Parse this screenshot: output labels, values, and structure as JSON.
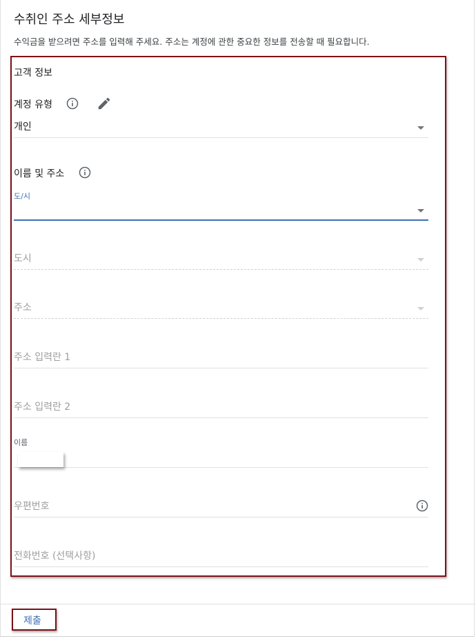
{
  "header": {
    "title": "수취인 주소 세부정보",
    "subtitle": "수익금을 받으려면 주소를 입력해 주세요. 주소는 계정에 관한 중요한 정보를 전송할 때 필요합니다."
  },
  "form": {
    "section_title": "고객 정보",
    "account_type": {
      "label": "계정 유형",
      "value": "개인",
      "info_icon": "info-icon",
      "edit_icon": "pencil-icon"
    },
    "name_address": {
      "label": "이름 및 주소",
      "info_icon": "info-icon"
    },
    "province": {
      "floating_label": "도/시",
      "value": ""
    },
    "city": {
      "placeholder": "도시"
    },
    "address": {
      "placeholder": "주소"
    },
    "address_line1": {
      "placeholder": "주소 입력란 1"
    },
    "address_line2": {
      "placeholder": "주소 입력란 2"
    },
    "name": {
      "floating_label": "이름",
      "value": ""
    },
    "postal_code": {
      "placeholder": "우편번호",
      "info_icon": "info-icon"
    },
    "phone": {
      "placeholder": "전화번호 (선택사항)"
    }
  },
  "footer": {
    "submit_label": "제출"
  },
  "colors": {
    "accent": "#3b6fb6",
    "highlight_border": "#7a1016"
  }
}
